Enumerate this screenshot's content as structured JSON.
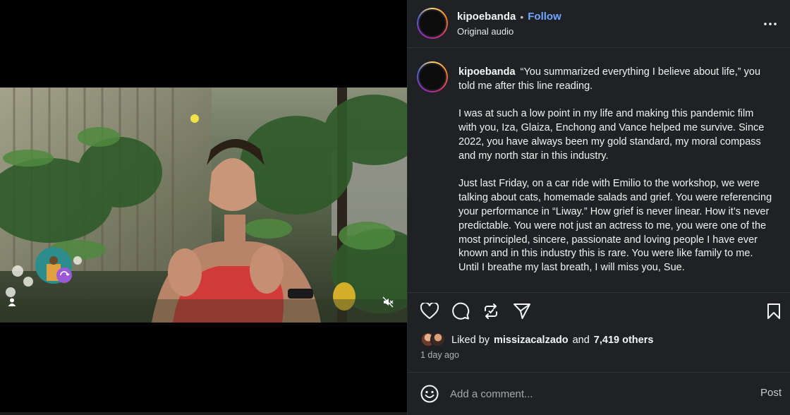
{
  "post": {
    "username": "kipoebanda",
    "follow_label": "Follow",
    "separator": "•",
    "audio_label": "Original audio"
  },
  "caption": {
    "username": "kipoebanda",
    "paragraphs": [
      "“You summarized everything I believe about life,” you told me after this line reading.",
      "I was at such a low point in my life and making this pandemic film with you, Iza, Glaiza, Enchong and Vance helped me survive. Since 2022, you have always been my gold standard, my moral compass and my north star in this industry.",
      "Just last Friday, on a car ride with Emilio to the workshop, we were talking about cats, homemade salads and grief. You were referencing your performance in “Liway.” How grief is never linear. How it’s never predictable. You were not just an actress to me, you were one of the most principled, sincere, passionate and loving people I have ever known and in this industry this is rare. You were like family to me. Until I breathe my last breath, I will miss you, Sue."
    ]
  },
  "likes": {
    "prefix": "Liked by",
    "liker": "missizacalzado",
    "connector": "and",
    "others": "7,419 others",
    "time_ago": "1 day ago"
  },
  "comment": {
    "placeholder": "Add a comment...",
    "post_label": "Post"
  },
  "icons": {
    "more": "more-horizontal-icon",
    "like": "heart-icon",
    "comment": "comment-icon",
    "repost": "repost-icon",
    "share": "send-icon",
    "save": "bookmark-icon",
    "emoji": "emoji-icon",
    "mute": "muted-speaker-icon",
    "tag": "user-tag-icon"
  },
  "colors": {
    "panel_bg": "#202124",
    "follow": "#6ea8ff",
    "text": "#f5f5f5",
    "muted_text": "#a8a8a8"
  }
}
